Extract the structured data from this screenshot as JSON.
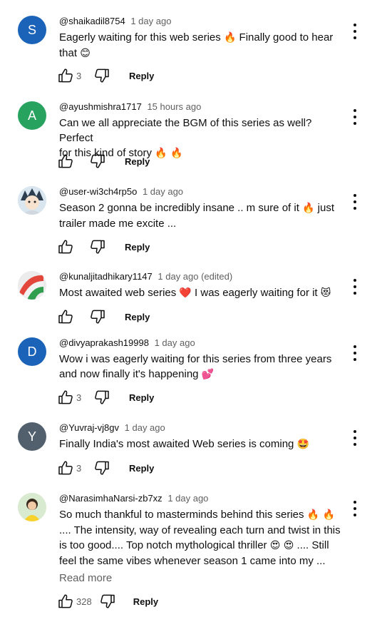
{
  "comments": [
    {
      "handle": "@shaikadil8754",
      "time": "1 day ago",
      "avatar_letter": "S",
      "avatar_color": "#1a63b8",
      "line1": "Eagerly waiting for this web series",
      "line1_emoji": "🔥",
      "line1_after": "Finally good to hear",
      "line2": "that",
      "line2_emoji": "😊",
      "likes": "3",
      "reply": "Reply"
    },
    {
      "handle": "@ayushmishra1717",
      "time": "15 hours ago",
      "avatar_letter": "A",
      "avatar_color": "#27a35f",
      "line1": "Can we all appreciate the BGM of this series as well? Perfect",
      "line2": "for this kind of story",
      "line2_emoji": "🔥 🔥",
      "likes": "",
      "reply": "Reply"
    },
    {
      "handle": "@user-wi3ch4rp5o",
      "time": "1 day ago",
      "line1": "Season 2 gonna be incredibly insane .. m sure of it",
      "line1_emoji": "🔥",
      "line1_after": "just",
      "line2": "trailer made me excite  ...",
      "likes": "",
      "reply": "Reply"
    },
    {
      "handle": "@kunaljitadhikary1147",
      "time": "1 day ago (edited)",
      "line1": "Most awaited web series",
      "line1_emoji": "❤️",
      "line1_after": "I was eagerly waiting for it",
      "line1_emoji2": "😻",
      "likes": "",
      "reply": "Reply"
    },
    {
      "handle": "@divyaprakash19998",
      "time": "1 day ago",
      "avatar_letter": "D",
      "avatar_color": "#1a63b8",
      "line1": "Wow i was eagerly waiting for this series from three years",
      "line2": "and now finally it's happening",
      "line2_emoji": "💕",
      "likes": "3",
      "reply": "Reply"
    },
    {
      "handle": "@Yuvraj-vj8gv",
      "time": "1 day ago",
      "avatar_letter": "Y",
      "avatar_color": "#52606d",
      "line1": "Finally India's most awaited Web series is coming",
      "line1_emoji": "🤩",
      "likes": "3",
      "reply": "Reply"
    },
    {
      "handle": "@NarasimhaNarsi-zb7xz",
      "time": "1 day ago",
      "line1": "So much thankful to masterminds behind this series",
      "line1_emoji": "🔥 🔥",
      "line2": ".... The intensity, way of revealing each turn and twist in this",
      "line3": "is too good.... Top notch mythological thriller",
      "line3_emoji": "😍 😍",
      "line3_after": ".... Still",
      "line4": "feel the same vibes whenever season 1 came into my ...",
      "read_more": "Read more",
      "likes": "328",
      "reply": "Reply"
    }
  ]
}
